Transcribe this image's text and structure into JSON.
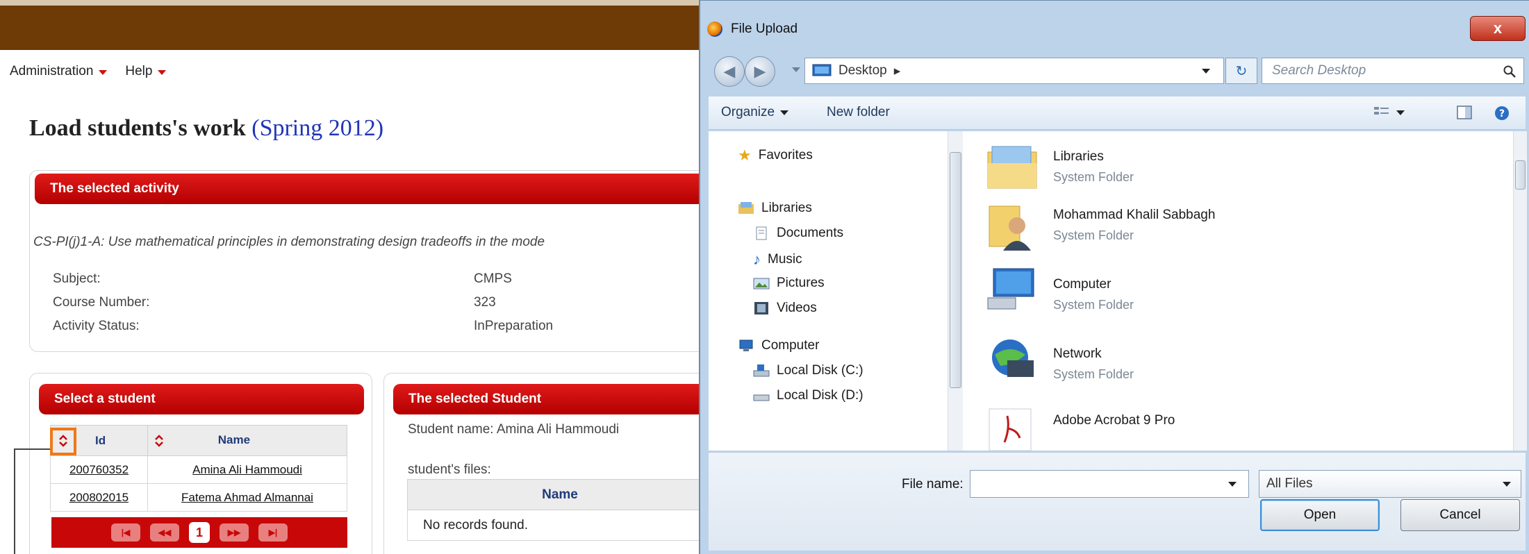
{
  "menu": {
    "administration": "Administration",
    "help": "Help"
  },
  "page": {
    "title": "Load students's work",
    "semester": "(Spring 2012)"
  },
  "activity_panel": {
    "header": "The selected activity",
    "description": "CS-PI(j)1-A: Use mathematical principles in demonstrating design tradeoffs in the mode",
    "fields": [
      {
        "label": "Subject:",
        "value": "CMPS"
      },
      {
        "label": "Course Number:",
        "value": "323"
      },
      {
        "label": "Activity Status:",
        "value": "InPreparation"
      }
    ]
  },
  "student_panel": {
    "header": "Select a student",
    "columns": {
      "id": "Id",
      "name": "Name"
    },
    "rows": [
      {
        "id": "200760352",
        "name": "Amina Ali Hammoudi"
      },
      {
        "id": "200802015",
        "name": "Fatema Ahmad Almannai"
      }
    ],
    "pager": {
      "current": "1"
    }
  },
  "selected_student_panel": {
    "header": "The selected Student",
    "student_name": "Student name: Amina Ali Hammoudi",
    "files_label": "student's files:",
    "files_column": "Name",
    "empty_message": "No records found."
  },
  "dialog": {
    "title": "File Upload",
    "close": "x",
    "address": "Desktop",
    "search_placeholder": "Search Desktop",
    "toolbar": {
      "organize": "Organize",
      "new_folder": "New folder"
    },
    "nav": {
      "favorites": "Favorites",
      "libraries": "Libraries",
      "documents": "Documents",
      "music": "Music",
      "pictures": "Pictures",
      "videos": "Videos",
      "computer": "Computer",
      "local_c": "Local Disk (C:)",
      "local_d": "Local Disk (D:)"
    },
    "items": [
      {
        "name": "Libraries",
        "type": "System Folder"
      },
      {
        "name": "Mohammad Khalil Sabbagh",
        "type": "System Folder"
      },
      {
        "name": "Computer",
        "type": "System Folder"
      },
      {
        "name": "Network",
        "type": "System Folder"
      },
      {
        "name": "Adobe Acrobat 9 Pro",
        "type": ""
      }
    ],
    "file_name_label": "File name:",
    "file_name_value": "",
    "filter": "All Files",
    "open": "Open",
    "cancel": "Cancel"
  },
  "colors": {
    "banner": "#6e3a06",
    "panel_header": "#c80808",
    "link": "#1f35b8",
    "dialog_frame": "#bcd3ea"
  }
}
